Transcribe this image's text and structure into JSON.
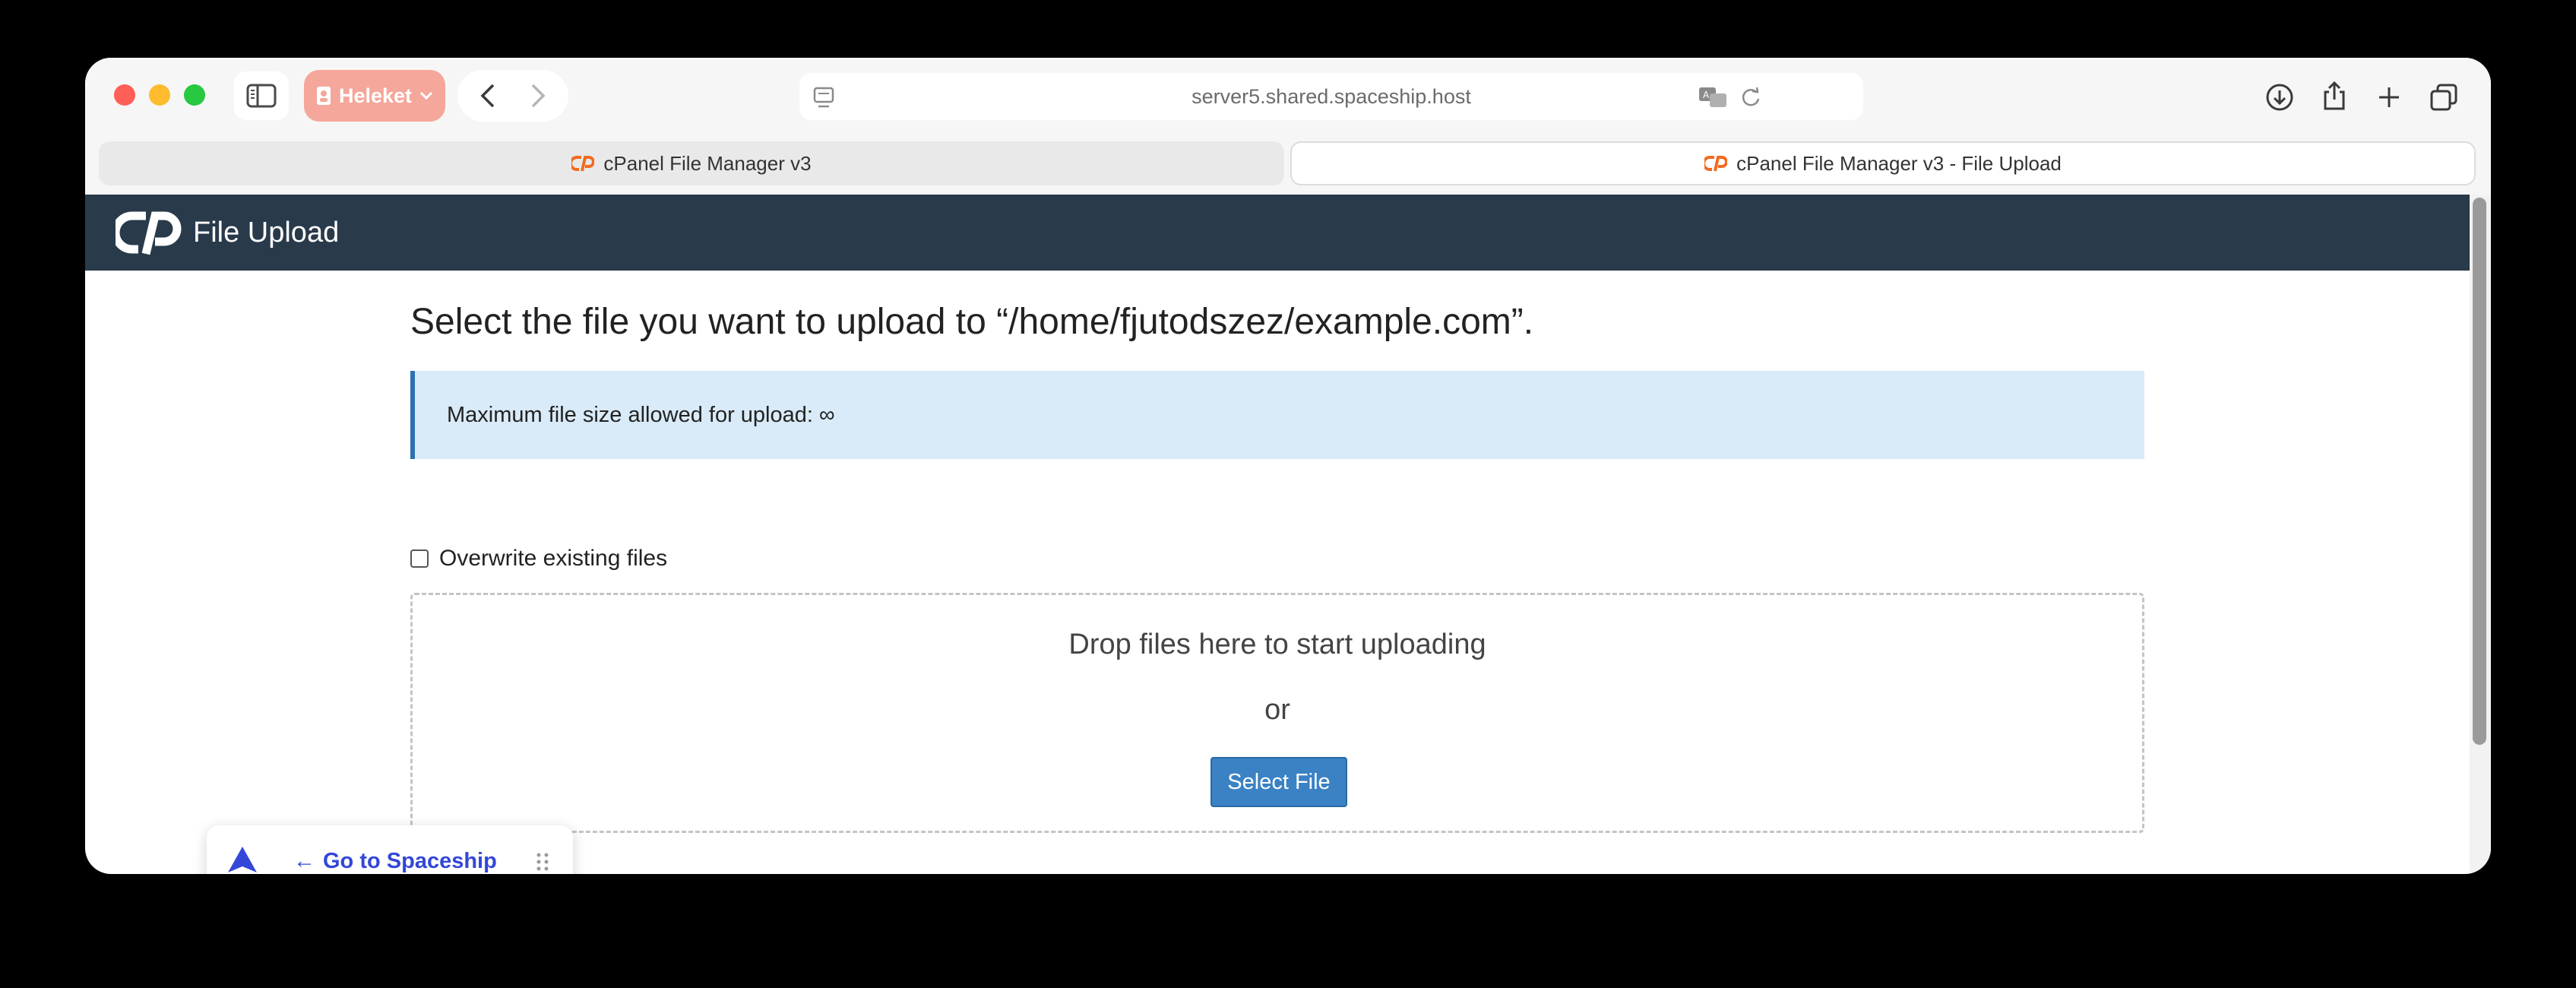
{
  "browser": {
    "profile_label": "Heleket",
    "address": "server5.shared.spaceship.host",
    "tabs": [
      {
        "label": "cPanel File Manager v3",
        "active": false
      },
      {
        "label": "cPanel File Manager v3 - File Upload",
        "active": true
      }
    ],
    "colors": {
      "profile": "#f4a79a",
      "toolbar": "#f6f6f6"
    }
  },
  "header": {
    "title": "File Upload",
    "background": "#293a4a",
    "icon": "cpanel-logo-icon"
  },
  "main": {
    "heading": "Select the file you want to upload to “/home/fjutodszez/example.com”.",
    "alert": "Maximum file size allowed for upload: ∞",
    "overwrite_label": "Overwrite existing files",
    "overwrite_checked": false,
    "dropzone": {
      "primary": "Drop files here to start uploading",
      "secondary": "or",
      "button": "Select File"
    },
    "colors": {
      "alert_bg": "#d9ebf8",
      "alert_border": "#2c71b0",
      "button": "#3a82c4"
    }
  },
  "widget": {
    "link_label": "Go to Spaceship",
    "arrow": "←",
    "color": "#3347d8"
  }
}
